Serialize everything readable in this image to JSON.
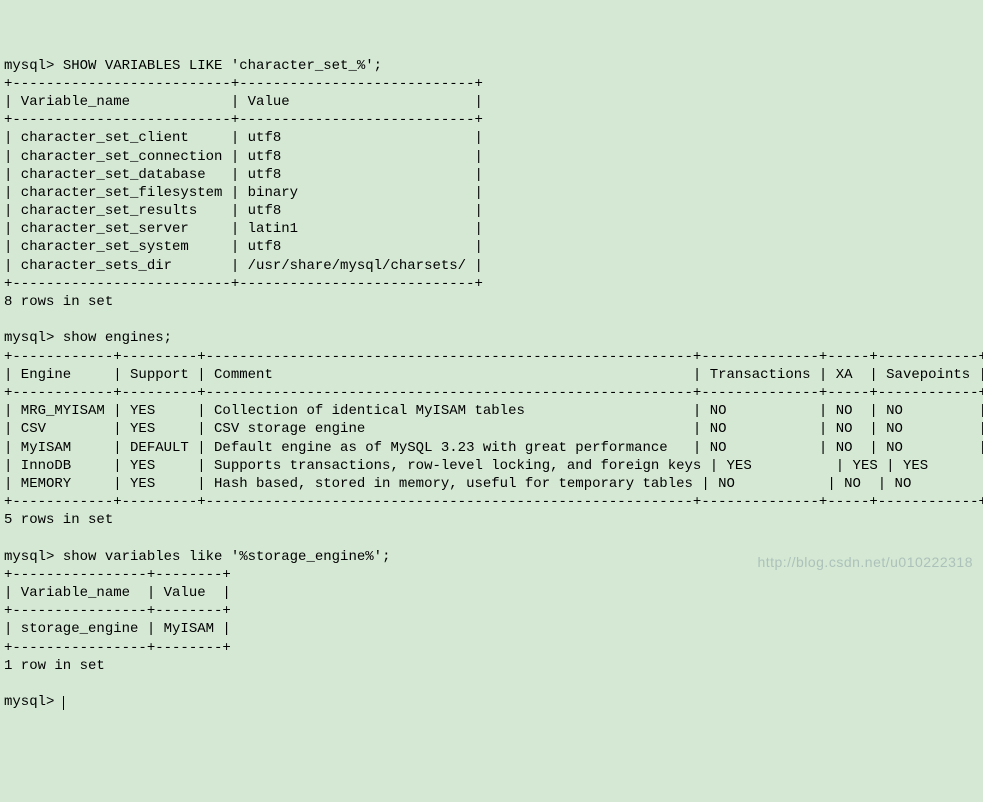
{
  "queries": [
    {
      "prompt": "mysql> ",
      "command": "SHOW VARIABLES LIKE 'character_set_%';",
      "border_top": "+--------------------------+----------------------------+",
      "header": "| Variable_name            | Value                      |",
      "border_mid": "+--------------------------+----------------------------+",
      "rows": [
        "| character_set_client     | utf8                       |",
        "| character_set_connection | utf8                       |",
        "| character_set_database   | utf8                       |",
        "| character_set_filesystem | binary                     |",
        "| character_set_results    | utf8                       |",
        "| character_set_server     | latin1                     |",
        "| character_set_system     | utf8                       |",
        "| character_sets_dir       | /usr/share/mysql/charsets/ |"
      ],
      "border_bot": "+--------------------------+----------------------------+",
      "summary": "8 rows in set"
    },
    {
      "prompt": "mysql> ",
      "command": "show engines;",
      "border_top": "+------------+---------+----------------------------------------------------------+--------------+-----+------------+",
      "header": "| Engine     | Support | Comment                                                  | Transactions | XA  | Savepoints |",
      "border_mid": "+------------+---------+----------------------------------------------------------+--------------+-----+------------+",
      "rows": [
        "| MRG_MYISAM | YES     | Collection of identical MyISAM tables                    | NO           | NO  | NO         |",
        "| CSV        | YES     | CSV storage engine                                       | NO           | NO  | NO         |",
        "| MyISAM     | DEFAULT | Default engine as of MySQL 3.23 with great performance   | NO           | NO  | NO         |",
        "| InnoDB     | YES     | Supports transactions, row-level locking, and foreign keys | YES          | YES | YES        |",
        "| MEMORY     | YES     | Hash based, stored in memory, useful for temporary tables | NO           | NO  | NO         |"
      ],
      "border_bot": "+------------+---------+----------------------------------------------------------+--------------+-----+------------+",
      "summary": "5 rows in set"
    },
    {
      "prompt": "mysql> ",
      "command": "show variables like '%storage_engine%';",
      "border_top": "+----------------+--------+",
      "header": "| Variable_name  | Value  |",
      "border_mid": "+----------------+--------+",
      "rows": [
        "| storage_engine | MyISAM |"
      ],
      "border_bot": "+----------------+--------+",
      "summary": "1 row in set"
    }
  ],
  "final_prompt": "mysql> ",
  "watermark": "http://blog.csdn.net/u010222318",
  "chart_data": {
    "type": "table",
    "tables": [
      {
        "title": "SHOW VARIABLES LIKE 'character_set_%'",
        "columns": [
          "Variable_name",
          "Value"
        ],
        "rows": [
          [
            "character_set_client",
            "utf8"
          ],
          [
            "character_set_connection",
            "utf8"
          ],
          [
            "character_set_database",
            "utf8"
          ],
          [
            "character_set_filesystem",
            "binary"
          ],
          [
            "character_set_results",
            "utf8"
          ],
          [
            "character_set_server",
            "latin1"
          ],
          [
            "character_set_system",
            "utf8"
          ],
          [
            "character_sets_dir",
            "/usr/share/mysql/charsets/"
          ]
        ]
      },
      {
        "title": "show engines",
        "columns": [
          "Engine",
          "Support",
          "Comment",
          "Transactions",
          "XA",
          "Savepoints"
        ],
        "rows": [
          [
            "MRG_MYISAM",
            "YES",
            "Collection of identical MyISAM tables",
            "NO",
            "NO",
            "NO"
          ],
          [
            "CSV",
            "YES",
            "CSV storage engine",
            "NO",
            "NO",
            "NO"
          ],
          [
            "MyISAM",
            "DEFAULT",
            "Default engine as of MySQL 3.23 with great performance",
            "NO",
            "NO",
            "NO"
          ],
          [
            "InnoDB",
            "YES",
            "Supports transactions, row-level locking, and foreign keys",
            "YES",
            "YES",
            "YES"
          ],
          [
            "MEMORY",
            "YES",
            "Hash based, stored in memory, useful for temporary tables",
            "NO",
            "NO",
            "NO"
          ]
        ]
      },
      {
        "title": "show variables like '%storage_engine%'",
        "columns": [
          "Variable_name",
          "Value"
        ],
        "rows": [
          [
            "storage_engine",
            "MyISAM"
          ]
        ]
      }
    ]
  }
}
